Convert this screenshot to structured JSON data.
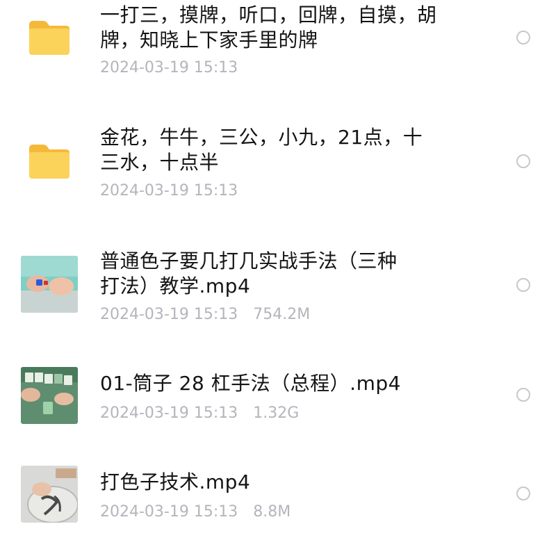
{
  "files": [
    {
      "type": "folder",
      "icon": "folder-icon",
      "name_line1": "一打三，摸牌，听口，回牌，自摸，胡",
      "name_line2": "牌，知晓上下家手里的牌",
      "date": "2024-03-19 15:13",
      "size": ""
    },
    {
      "type": "folder",
      "icon": "folder-icon",
      "name_line1": "金花，牛牛，三公，小九，21点，十",
      "name_line2": "三水，十点半",
      "date": "2024-03-19 15:13",
      "size": ""
    },
    {
      "type": "video",
      "icon": "video-thumbnail",
      "name_line1": "普通色子要几打几实战手法（三种",
      "name_line2": "打法）教学.mp4",
      "date": "2024-03-19 15:13",
      "size": "754.2M"
    },
    {
      "type": "video",
      "icon": "video-thumbnail",
      "name_line1": "01-筒子 28 杠手法（总程）.mp4",
      "name_line2": "",
      "date": "2024-03-19 15:13",
      "size": "1.32G"
    },
    {
      "type": "video",
      "icon": "video-thumbnail",
      "name_line1": "打色子技术.mp4",
      "name_line2": "",
      "date": "2024-03-19 15:13",
      "size": "8.8M"
    }
  ],
  "colors": {
    "folder_yellow": "#f9c94a",
    "meta_gray": "#b4b4bc",
    "radio_border": "#c8c8cc"
  }
}
